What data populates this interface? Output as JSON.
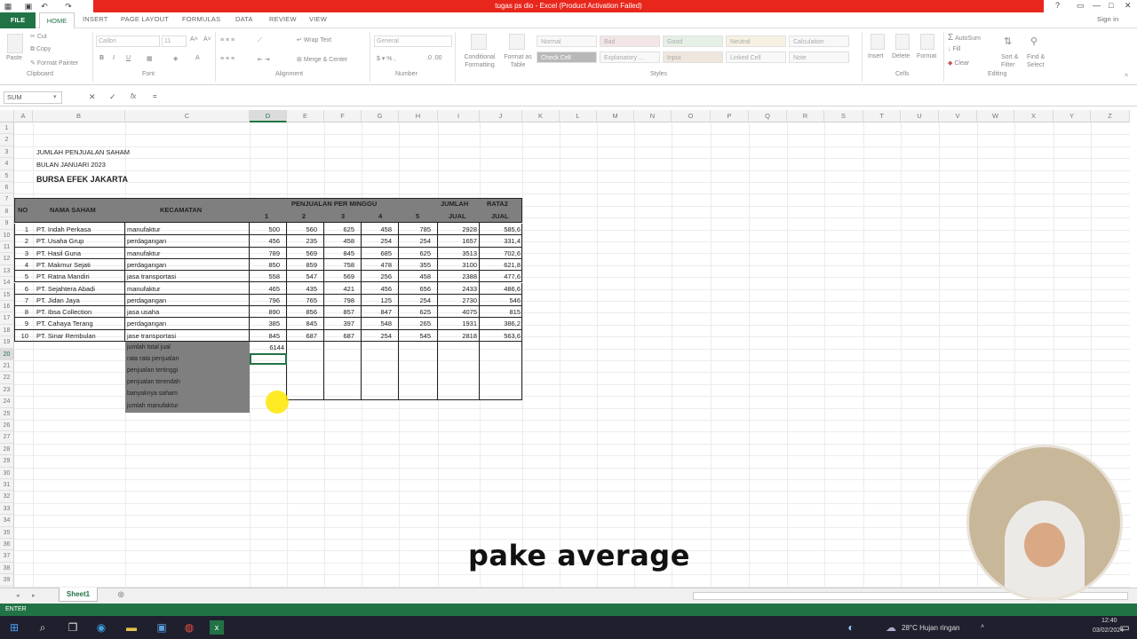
{
  "title_bar": {
    "text": "tugas ps dio - Excel (Product Activation Failed)",
    "help": "?",
    "minimize": "—",
    "restore": "□",
    "close": "✕"
  },
  "tabs": {
    "file": "FILE",
    "home": "HOME",
    "insert": "INSERT",
    "page_layout": "PAGE LAYOUT",
    "formulas": "FORMULAS",
    "data": "DATA",
    "review": "REVIEW",
    "view": "VIEW",
    "signin": "Sign in"
  },
  "ribbon": {
    "paste": "Paste",
    "cut": "Cut",
    "copy": "Copy",
    "format_painter": "Format Painter",
    "clipboard": "Clipboard",
    "font_name": "Calibri",
    "font_size": "11",
    "font": "Font",
    "wrap_text": "Wrap Text",
    "merge_center": "Merge & Center",
    "alignment": "Alignment",
    "number_format": "General",
    "number": "Number",
    "conditional_formatting": "Conditional Formatting",
    "format_as_table": "Format as Table",
    "styles": [
      "Normal",
      "Bad",
      "Good",
      "Neutral",
      "Calculation",
      "Check Cell",
      "Explanatory ...",
      "Input",
      "Linked Cell",
      "Note"
    ],
    "styles_label": "Styles",
    "insert": "Insert",
    "delete": "Delete",
    "format": "Format",
    "cells": "Cells",
    "autosum": "AutoSum",
    "fill": "Fill",
    "clear": "Clear",
    "sort_filter": "Sort & Filter",
    "find_select": "Find & Select",
    "editing": "Editing"
  },
  "formula_bar": {
    "name_box": "SUM",
    "cancel": "✕",
    "enter": "✓",
    "fx": "fx",
    "content": "="
  },
  "columns": [
    "A",
    "B",
    "C",
    "D",
    "E",
    "F",
    "G",
    "H",
    "I",
    "J",
    "K",
    "L",
    "M",
    "N",
    "O",
    "P",
    "Q",
    "R",
    "S",
    "T",
    "U",
    "V",
    "W",
    "X",
    "Y",
    "Z"
  ],
  "sheet": {
    "title1": "JUMLAH PENJUALAN SAHAM",
    "title2": "BULAN JANUARI 2023",
    "title3": "BURSA EFEK JAKARTA",
    "hdr_no": "NO",
    "hdr_nama": "NAMA SAHAM",
    "hdr_kec": "KECAMATAN",
    "hdr_penjualan": "PENJUALAN PER MINGGU",
    "hdr_jumlah1": "JUMLAH",
    "hdr_jumlah2": "JUAL",
    "hdr_rata1": "RATA2",
    "hdr_rata2": "JUAL",
    "weeks": [
      "1",
      "2",
      "3",
      "4",
      "5"
    ],
    "rows": [
      {
        "no": "1",
        "nama": "PT. Indah Perkasa",
        "kec": "manufaktur",
        "w": [
          "500",
          "560",
          "625",
          "458",
          "785"
        ],
        "jml": "2928",
        "rata": "585,6"
      },
      {
        "no": "2",
        "nama": "PT. Usaha Grup",
        "kec": "perdagangan",
        "w": [
          "456",
          "235",
          "458",
          "254",
          "254"
        ],
        "jml": "1657",
        "rata": "331,4"
      },
      {
        "no": "3",
        "nama": "PT. Hasil Guna",
        "kec": "manufaktur",
        "w": [
          "789",
          "569",
          "845",
          "685",
          "625"
        ],
        "jml": "3513",
        "rata": "702,6"
      },
      {
        "no": "4",
        "nama": "PT. Makmur Sejati",
        "kec": "perdagangan",
        "w": [
          "850",
          "859",
          "758",
          "478",
          "355"
        ],
        "jml": "3100",
        "rata": "621,8"
      },
      {
        "no": "5",
        "nama": "PT. Ratna Mandiri",
        "kec": "jasa transportasi",
        "w": [
          "558",
          "547",
          "569",
          "256",
          "458"
        ],
        "jml": "2388",
        "rata": "477,6"
      },
      {
        "no": "6",
        "nama": "PT. Sejahtera Abadi",
        "kec": "manufaktur",
        "w": [
          "465",
          "435",
          "421",
          "456",
          "656"
        ],
        "jml": "2433",
        "rata": "486,6"
      },
      {
        "no": "7",
        "nama": "PT. Jidan Jaya",
        "kec": "perdagangan",
        "w": [
          "796",
          "765",
          "798",
          "125",
          "254"
        ],
        "jml": "2730",
        "rata": "546"
      },
      {
        "no": "8",
        "nama": "PT. Ibsa Collection",
        "kec": "jasa usaha",
        "w": [
          "890",
          "856",
          "857",
          "847",
          "625"
        ],
        "jml": "4075",
        "rata": "815"
      },
      {
        "no": "9",
        "nama": "PT. Cahaya Terang",
        "kec": "perdagangan",
        "w": [
          "385",
          "845",
          "397",
          "548",
          "265"
        ],
        "jml": "1931",
        "rata": "386,2"
      },
      {
        "no": "10",
        "nama": "PT. Sinar Rembulan",
        "kec": "jase transportasi",
        "w": [
          "845",
          "687",
          "687",
          "254",
          "545"
        ],
        "jml": "2818",
        "rata": "563,6"
      }
    ],
    "summary": [
      "jumlah total jual",
      "rata rata penjualan",
      "penjualan tertinggi",
      "penjualan terendah",
      "banyaknya saham",
      "jumlah manufaktur"
    ],
    "total_value": "6144"
  },
  "sheet_tab": "Sheet1",
  "status": "ENTER",
  "caption": "pake average",
  "taskbar": {
    "weather": "28°C  Hujan ringan",
    "time": "12:40",
    "date": "03/02/2024"
  }
}
